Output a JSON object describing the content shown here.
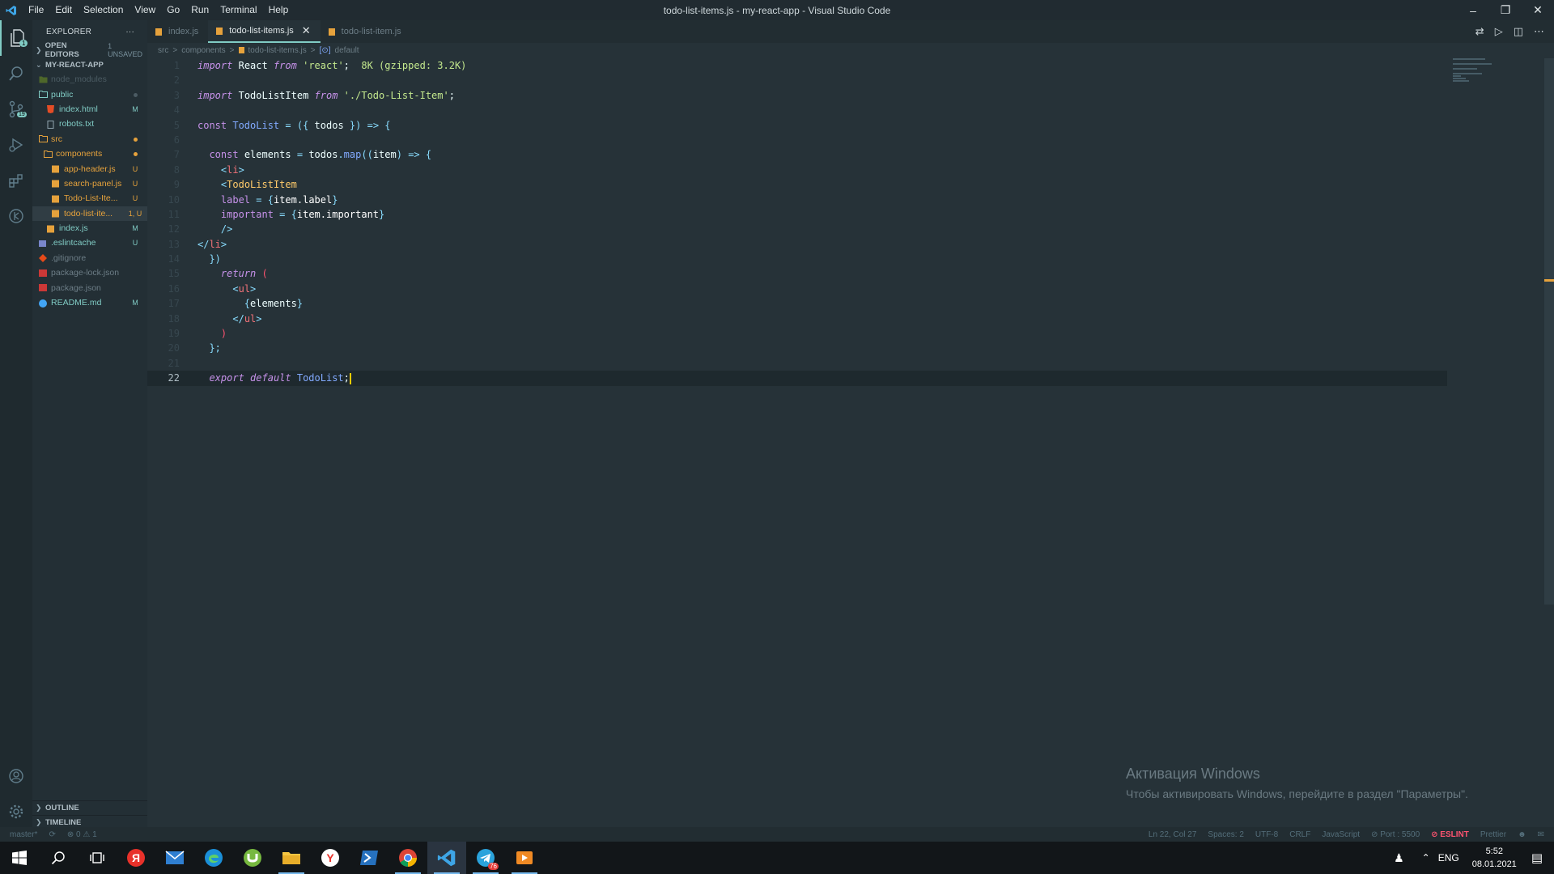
{
  "window": {
    "title": "todo-list-items.js - my-react-app - Visual Studio Code"
  },
  "menu": [
    "File",
    "Edit",
    "Selection",
    "View",
    "Go",
    "Run",
    "Terminal",
    "Help"
  ],
  "activity": {
    "scm_badge": "19",
    "explorer_badge": "1"
  },
  "sidebar": {
    "header": "EXPLORER",
    "more": "···",
    "open_editors": {
      "label": "OPEN EDITORS",
      "extra": "1 UNSAVED"
    },
    "project": {
      "label": "MY-REACT-APP"
    },
    "tree": [
      {
        "name": "node_modules",
        "badge": "",
        "color": "#4b5b63",
        "type": "folder-dim"
      },
      {
        "name": "public",
        "badge": "dot",
        "color": "#80cbc4",
        "type": "folder"
      },
      {
        "name": "index.html",
        "badge": "M",
        "color": "#80cbc4",
        "type": "html"
      },
      {
        "name": "robots.txt",
        "badge": "",
        "color": "#80cbc4",
        "type": "txt"
      },
      {
        "name": "src",
        "badge": "dot-yellow",
        "color": "#e6a23c",
        "type": "folder"
      },
      {
        "name": "components",
        "badge": "dot-yellow",
        "color": "#e6a23c",
        "type": "folder"
      },
      {
        "name": "app-header.js",
        "badge": "U",
        "color": "#e6a23c",
        "type": "js"
      },
      {
        "name": "search-panel.js",
        "badge": "U",
        "color": "#e6a23c",
        "type": "js"
      },
      {
        "name": "Todo-List-Ite...",
        "badge": "U",
        "color": "#e6a23c",
        "type": "js"
      },
      {
        "name": "todo-list-ite...",
        "badge": "1, U",
        "color": "#e6a23c",
        "type": "js"
      },
      {
        "name": "index.js",
        "badge": "M",
        "color": "#80cbc4",
        "type": "js"
      },
      {
        "name": ".eslintcache",
        "badge": "U",
        "color": "#80cbc4",
        "type": "file"
      },
      {
        "name": ".gitignore",
        "badge": "",
        "color": "#6c7d86",
        "type": "git"
      },
      {
        "name": "package-lock.json",
        "badge": "",
        "color": "#6c7d86",
        "type": "npm"
      },
      {
        "name": "package.json",
        "badge": "",
        "color": "#6c7d86",
        "type": "npm"
      },
      {
        "name": "README.md",
        "badge": "M",
        "color": "#80cbc4",
        "type": "info"
      }
    ],
    "outline": "OUTLINE",
    "timeline": "TIMELINE"
  },
  "tabs": [
    {
      "label": "index.js",
      "active": false
    },
    {
      "label": "todo-list-items.js",
      "active": true
    },
    {
      "label": "todo-list-item.js",
      "active": false
    }
  ],
  "breadcrumb": [
    "src",
    ">",
    "components",
    ">",
    "todo-list-items.js",
    ">",
    "default"
  ],
  "code": {
    "line_numbers": [
      "1",
      "2",
      "3",
      "4",
      "5",
      "6",
      "7",
      "8",
      "9",
      "10",
      "11",
      "12",
      "13",
      "14",
      "15",
      "16",
      "17",
      "18",
      "19",
      "20",
      "21",
      "22"
    ],
    "import_hint": "8K (gzipped: 3.2K)"
  },
  "watermark": {
    "title": "Активация Windows",
    "subtitle": "Чтобы активировать Windows, перейдите в раздел \"Параметры\"."
  },
  "statusbar": {
    "branch": "master*",
    "sync": "⟳",
    "problems": "⊗ 0 ⚠ 1",
    "position": "Ln 22, Col 27",
    "spaces": "Spaces: 2",
    "encoding": "UTF-8",
    "eol": "CRLF",
    "language": "JavaScript",
    "port": "⊘ Port : 5500",
    "eslint": "⊘ ESLINT",
    "prettier": "Prettier"
  },
  "taskbar": {
    "lang": "ENG",
    "time": "5:52",
    "date": "08.01.2021",
    "telegram_badge": "76"
  }
}
